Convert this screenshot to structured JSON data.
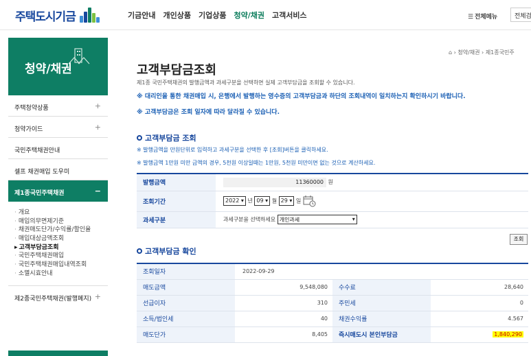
{
  "header": {
    "logo_text": "주택도시기금",
    "nav": [
      "기금안내",
      "개인상품",
      "기업상품",
      "청약/채권",
      "고객서비스"
    ],
    "nav_active_index": 3,
    "allmenu_label": "전체메뉴",
    "search_select": "전체검"
  },
  "sidebar": {
    "title": "청약/채권",
    "items": [
      {
        "label": "주택청약상품",
        "expand": "+"
      },
      {
        "label": "청약가이드",
        "expand": "+"
      },
      {
        "label": "국민주택채권안내",
        "expand": ""
      },
      {
        "label": "셀프 채권매입 도우미",
        "expand": ""
      },
      {
        "label": "제1종국민주택채권",
        "expand": "−"
      }
    ],
    "subitems": [
      "개요",
      "매입의무면제기준",
      "채권매도단가/수익률/할인율",
      "매입대상금액조회",
      "고객부담금조회",
      "국민주택채권매입",
      "국민주택채권매입내역조회",
      "소멸시효안내"
    ],
    "current_sub_index": 4,
    "item_after": {
      "label": "제2종국민주택채권(발행폐지)",
      "expand": "+"
    }
  },
  "breadcrumb": [
    "청약/채권",
    "제1종국민주"
  ],
  "page": {
    "title": "고객부담금조회",
    "desc": "제1종 국민주택채권의 발행금액과 과세구분을 선택하면 실제 고객부담금을 조회할 수 있습니다.",
    "notice1": "※ 대리인을 통한 채권매입 시, 은행에서 발행하는 영수증의 고객부담금과 하단의 조회내역이 일치하는지 확인하시기 바랍니다.",
    "notice2": "※ 고객부담금은 조회 일자에 따라 달라질 수 있습니다."
  },
  "inquiry": {
    "title": "고객부담금 조회",
    "guide1": "※ 발행금액을 만원단위로 입력하고 과세구분을 선택한 후 [조회]버튼을 클릭하세요.",
    "guide2": "※ 발행금액 1만원 미만 금액의 경우, 5천원 이상일때는 1만원, 5천원 미만이면 없는 것으로 계산하세요.",
    "amount_label": "발행금액",
    "amount_value": "11360000",
    "amount_unit": "원",
    "period_label": "조회기간",
    "year": "2022",
    "year_unit": "년",
    "month": "09",
    "month_unit": "월",
    "day": "29",
    "day_unit": "일",
    "tax_label": "과세구분",
    "tax_prompt": "과세구분을 선택하세요",
    "tax_value": "개인과세",
    "search_button": "조회"
  },
  "result": {
    "title": "고객부담금 확인",
    "date_label": "조회일자",
    "date_value": "2022-09-29",
    "rows": [
      {
        "l1": "매도금액",
        "v1": "9,548,080",
        "l2": "수수료",
        "v2": "28,640"
      },
      {
        "l1": "선급이자",
        "v1": "310",
        "l2": "주민세",
        "v2": "0"
      },
      {
        "l1": "소득/법인세",
        "v1": "40",
        "l2": "채권수익률",
        "v2": "4.567"
      },
      {
        "l1": "매도단가",
        "v1": "8,405",
        "l2": "즉시매도시 본인부담금",
        "v2": "1,840,290"
      }
    ]
  },
  "colors": {
    "brand_green": "#0e7e64",
    "brand_blue": "#17479d",
    "highlight": "#ffff00"
  }
}
